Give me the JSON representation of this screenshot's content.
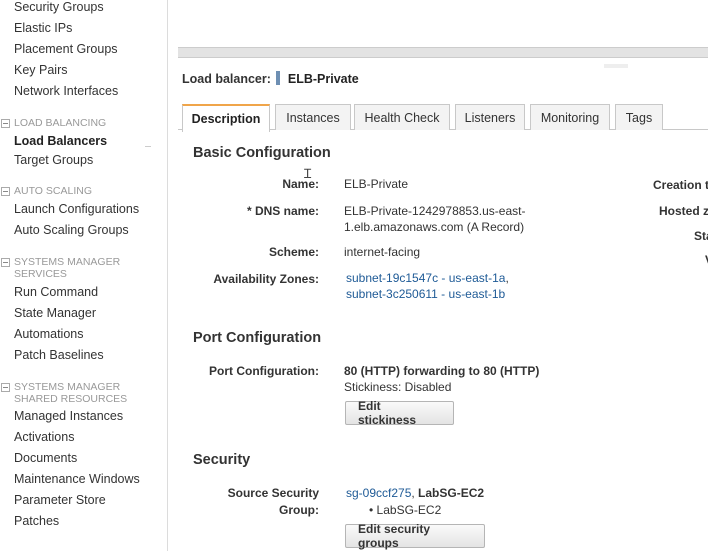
{
  "sidebar": {
    "items_top": [
      "Security Groups",
      "Elastic IPs",
      "Placement Groups",
      "Key Pairs",
      "Network Interfaces"
    ],
    "load_balancing": {
      "header": "LOAD BALANCING",
      "items": [
        "Load Balancers",
        "Target Groups"
      ]
    },
    "auto_scaling": {
      "header": "AUTO SCALING",
      "items": [
        "Launch Configurations",
        "Auto Scaling Groups"
      ]
    },
    "systems_manager_services": {
      "header": "SYSTEMS MANAGER\nSERVICES",
      "items": [
        "Run Command",
        "State Manager",
        "Automations",
        "Patch Baselines"
      ]
    },
    "systems_manager_shared": {
      "header": "SYSTEMS MANAGER\nSHARED RESOURCES",
      "items": [
        "Managed Instances",
        "Activations",
        "Documents",
        "Maintenance Windows",
        "Parameter Store",
        "Patches"
      ]
    }
  },
  "header": {
    "label": "Load balancer:",
    "name": "ELB-Private"
  },
  "tabs": [
    "Description",
    "Instances",
    "Health Check",
    "Listeners",
    "Monitoring",
    "Tags"
  ],
  "basic": {
    "title": "Basic Configuration",
    "name_label": "Name:",
    "name_value": "ELB-Private",
    "dns_label": "* DNS name:",
    "dns_line1": "ELB-Private-1242978853.us-east-",
    "dns_line2": "1.elb.amazonaws.com (A Record)",
    "scheme_label": "Scheme:",
    "scheme_value": "internet-facing",
    "az_label": "Availability Zones:",
    "az1": "subnet-19c1547c - us-east-1a",
    "az2": "subnet-3c250611 - us-east-1b",
    "right_labels": [
      "Creation t",
      "Hosted z",
      "Sta",
      "V"
    ]
  },
  "port": {
    "title": "Port Configuration",
    "label": "Port Configuration:",
    "value": "80 (HTTP) forwarding to 80 (HTTP)",
    "stickiness": "Stickiness: Disabled",
    "edit_button": "Edit stickiness"
  },
  "security": {
    "title": "Security",
    "label_line1": "Source Security",
    "label_line2": "Group:",
    "sg_link": "sg-09ccf275",
    "sg_name": "LabSG-EC2",
    "sg_bullet": "LabSG-EC2",
    "edit_button": "Edit security groups"
  }
}
